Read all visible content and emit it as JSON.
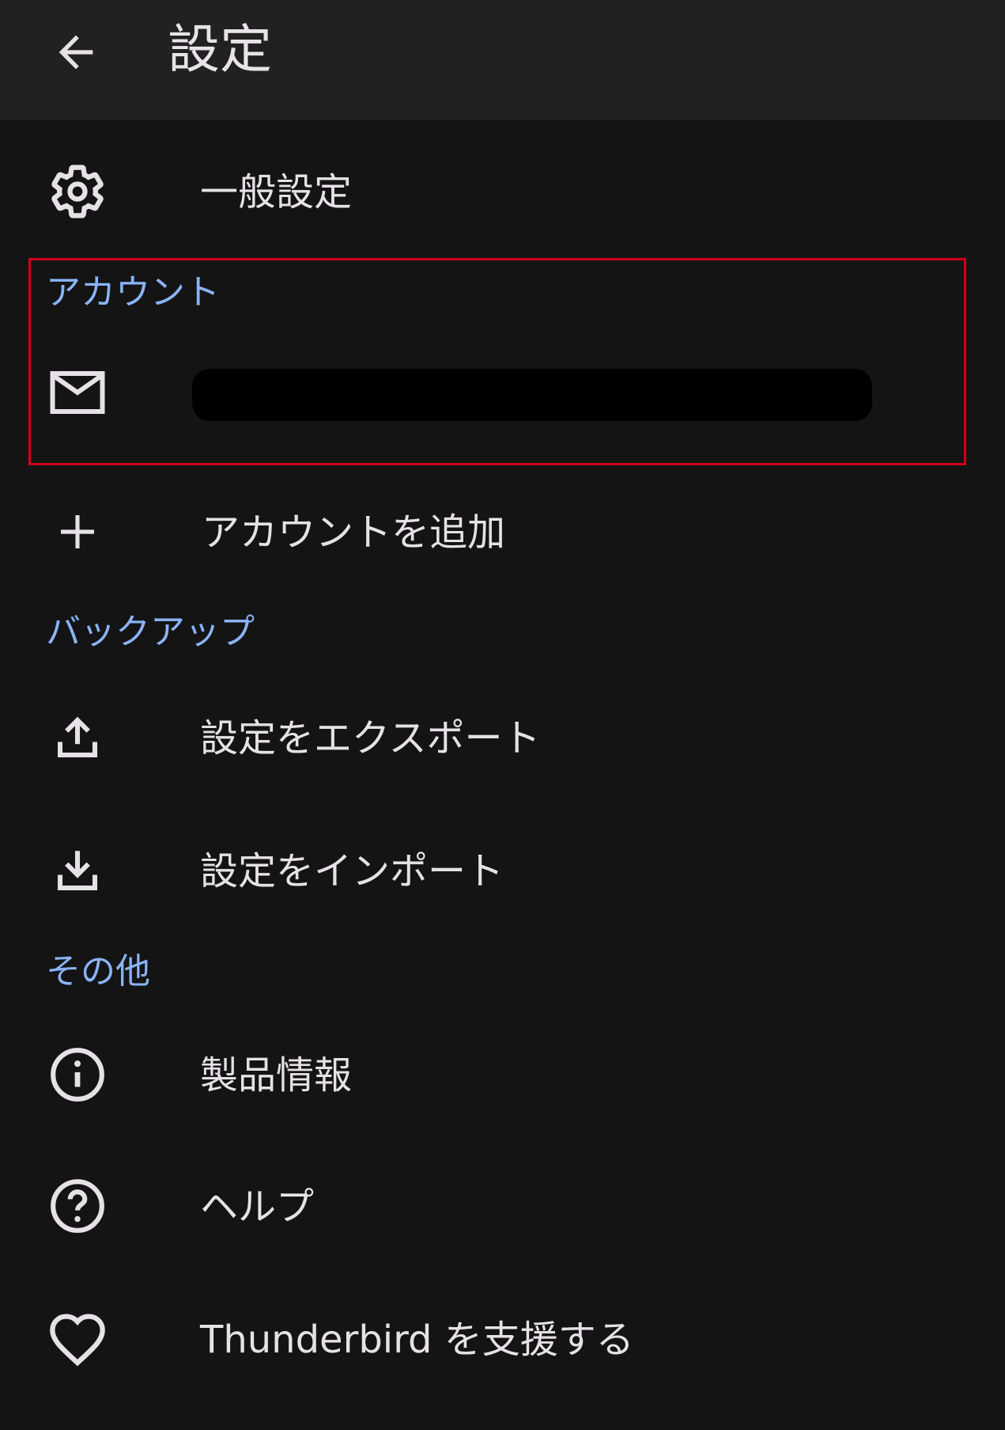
{
  "appbar": {
    "title": "設定"
  },
  "general": {
    "label": "一般設定",
    "icon": "gear-icon"
  },
  "accounts": {
    "header": "アカウント",
    "account_icon": "mail-icon",
    "add_account_label": "アカウントを追加",
    "add_icon": "plus-icon"
  },
  "backup": {
    "header": "バックアップ",
    "export_label": "設定をエクスポート",
    "import_label": "設定をインポート"
  },
  "other": {
    "header": "その他",
    "about_label": "製品情報",
    "help_label": "ヘルプ",
    "donate_label": "Thunderbird を支援する"
  },
  "colors": {
    "background": "#141414",
    "appbar": "#212121",
    "section_header": "#8ab4f8",
    "highlight_border": "#d0021b"
  }
}
